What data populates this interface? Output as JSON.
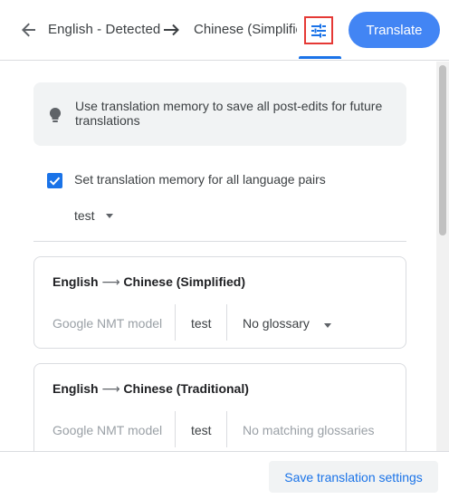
{
  "header": {
    "source_language": "English - Detected",
    "target_language": "Chinese (Simplified)",
    "translate_label": "Translate"
  },
  "info": {
    "text": "Use translation memory to save all post-edits for future translations"
  },
  "memory": {
    "checkbox_label": "Set translation memory for all language pairs",
    "checked": true,
    "selected": "test"
  },
  "pairs": [
    {
      "source": "English",
      "target": "Chinese (Simplified)",
      "model": "Google NMT model",
      "memory": "test",
      "glossary": "No glossary"
    },
    {
      "source": "English",
      "target": "Chinese (Traditional)",
      "model": "Google NMT model",
      "memory": "test",
      "glossary": "No matching glossaries"
    }
  ],
  "footer": {
    "save_label": "Save translation settings"
  },
  "colors": {
    "accent": "#1a73e8",
    "primary_button": "#4285f4",
    "highlight_border": "#e53935"
  }
}
